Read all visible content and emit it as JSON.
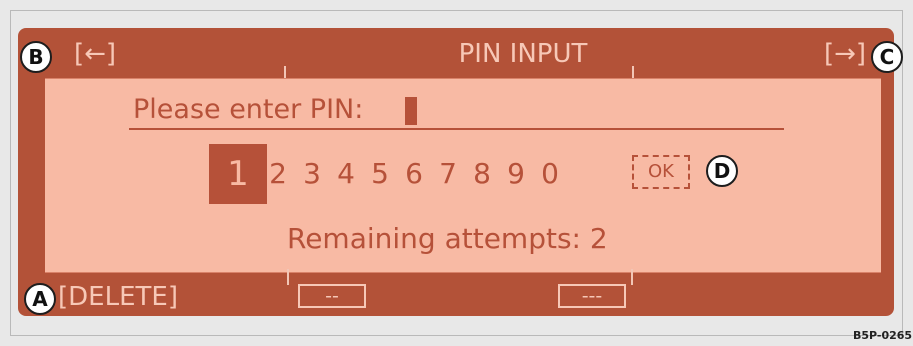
{
  "header": {
    "title": "PIN INPUT",
    "left_action": "[←]",
    "right_action": "[→]"
  },
  "screen": {
    "prompt": "Please enter PIN:",
    "digits": [
      "1",
      "2",
      "3",
      "4",
      "5",
      "6",
      "7",
      "8",
      "9",
      "0"
    ],
    "selected_digit": "1",
    "ok_label": "OK",
    "attempts": "Remaining attempts: 2"
  },
  "footer": {
    "delete_label": "[DELETE]",
    "softkey_1": "--",
    "softkey_2": "---"
  },
  "callouts": {
    "a": "A",
    "b": "B",
    "c": "C",
    "d": "D"
  },
  "code_label": "B5P-0265"
}
